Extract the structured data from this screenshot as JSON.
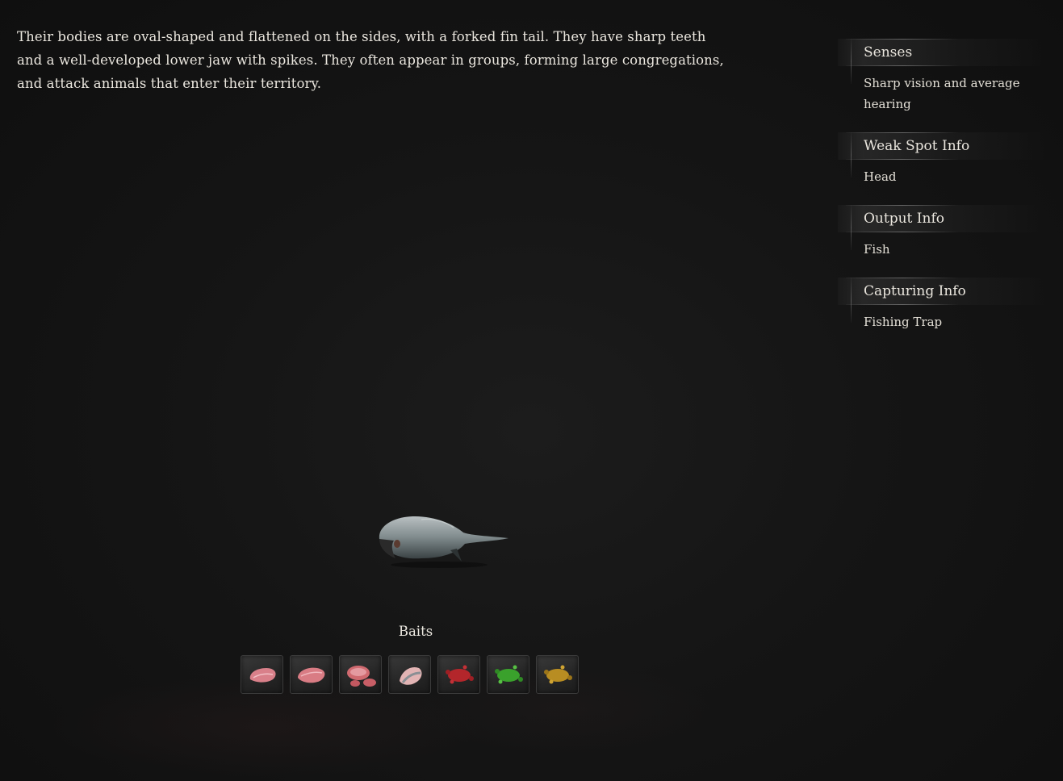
{
  "description": "Their bodies are oval-shaped and flattened on the sides, with a forked fin tail. They have sharp teeth and a well-developed lower jaw with spikes. They often appear in groups, forming large congregations, and attack animals that enter their territory.",
  "info_sections": [
    {
      "title": "Senses",
      "value": "Sharp vision and average hearing"
    },
    {
      "title": "Weak Spot Info",
      "value": "Head"
    },
    {
      "title": "Output Info",
      "value": "Fish"
    },
    {
      "title": "Capturing Info",
      "value": "Fishing Trap"
    }
  ],
  "creature_icon": "fish-model-icon",
  "baits": {
    "label": "Baits",
    "items": [
      {
        "icon": "raw-meat-icon",
        "color": "#d9808a"
      },
      {
        "icon": "raw-meat-icon",
        "color": "#d97c84"
      },
      {
        "icon": "sliced-meat-icon",
        "color": "#d06a70"
      },
      {
        "icon": "raw-fish-icon",
        "color": "#e2b4b4"
      },
      {
        "icon": "red-bait-splat-icon",
        "color": "#b3262b"
      },
      {
        "icon": "green-bait-splat-icon",
        "color": "#3aa12c"
      },
      {
        "icon": "yellow-bait-splat-icon",
        "color": "#b88d22"
      }
    ]
  }
}
